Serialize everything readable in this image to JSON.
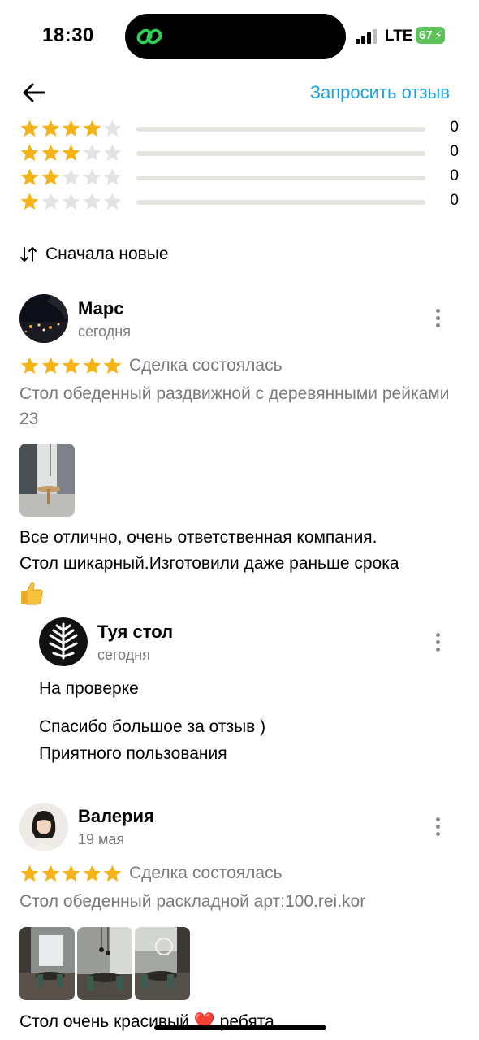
{
  "status_bar": {
    "time": "18:30",
    "network": "LTE",
    "battery": "67"
  },
  "header": {
    "back_icon": "arrow-left-icon",
    "request_review_label": "Запросить отзыв"
  },
  "rating_breakdown": [
    {
      "stars": 4,
      "count": "0"
    },
    {
      "stars": 3,
      "count": "0"
    },
    {
      "stars": 2,
      "count": "0"
    },
    {
      "stars": 1,
      "count": "0"
    }
  ],
  "sort": {
    "icon": "sort-arrows-icon",
    "label": "Сначала новые"
  },
  "colors": {
    "accent": "#1aa1e6",
    "star": "#f5b318",
    "star_empty": "#e3e3e3",
    "muted": "#7a7a7a"
  },
  "reviews": [
    {
      "author": "Марс",
      "date": "сегодня",
      "rating": 5,
      "deal_status": "Сделка состоялась",
      "product": "Стол обеденный раздвижной с деревянными рейками 23",
      "photo_count": 1,
      "text_line1": "Все отлично, очень ответственная компания.",
      "text_line2": "Стол шикарный.Изготовили даже раньше срока",
      "emoji": "thumbs-up",
      "reply": {
        "author": "Туя стол",
        "date": "сегодня",
        "status": "На проверке",
        "text_line1": "Спасибо большое за отзыв )",
        "text_line2": "Приятного пользования"
      }
    },
    {
      "author": "Валерия",
      "date": "19 мая",
      "rating": 5,
      "deal_status": "Сделка состоялась",
      "product": "Стол обеденный раскладной арт:100.rei.kor",
      "photo_count": 3,
      "text_line1": "Стол очень красивый ❤️ ребята"
    }
  ]
}
